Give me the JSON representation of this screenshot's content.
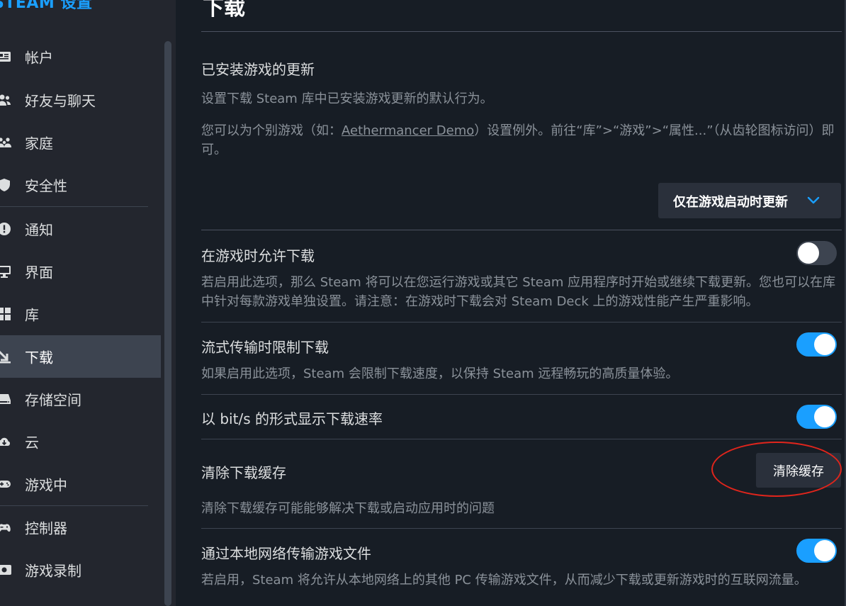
{
  "sidebar": {
    "title": "STEAM 设置",
    "items": [
      {
        "label": "帐户",
        "icon": "account-icon"
      },
      {
        "label": "好友与聊天",
        "icon": "friends-icon"
      },
      {
        "label": "家庭",
        "icon": "family-icon"
      },
      {
        "label": "安全性",
        "icon": "shield-icon"
      },
      {
        "label": "通知",
        "icon": "notification-icon"
      },
      {
        "label": "界面",
        "icon": "monitor-icon"
      },
      {
        "label": "库",
        "icon": "library-icon"
      },
      {
        "label": "下载",
        "icon": "download-icon",
        "active": true
      },
      {
        "label": "存储空间",
        "icon": "storage-icon"
      },
      {
        "label": "云",
        "icon": "cloud-icon"
      },
      {
        "label": "游戏中",
        "icon": "gamepad-icon"
      },
      {
        "label": "控制器",
        "icon": "controller-icon"
      },
      {
        "label": "游戏录制",
        "icon": "recording-icon"
      }
    ]
  },
  "main": {
    "title": "下载",
    "installed_updates": {
      "heading": "已安装游戏的更新",
      "desc1": "设置下载 Steam 库中已安装游戏更新的默认行为。",
      "desc2_before": "您可以为个别游戏（如：",
      "desc2_link": "Aethermancer Demo",
      "desc2_after": "）设置例外。前往“库”>“游戏”>“属性...”（从齿轮图标访问）即可。",
      "dropdown_value": "仅在游戏启动时更新"
    },
    "allow_during_gameplay": {
      "heading": "在游戏时允许下载",
      "desc": "若启用此选项，那么 Steam 将可以在您运行游戏或其它 Steam 应用程序时开始或继续下载更新。您也可以在库中针对每款游戏单独设置。请注意：在游戏时下载会对 Steam Deck 上的游戏性能产生严重影响。",
      "enabled": false
    },
    "throttle_streaming": {
      "heading": "流式传输时限制下载",
      "desc": "如果启用此选项，Steam 会限制下载速度，以保持 Steam 远程畅玩的高质量体验。",
      "enabled": true
    },
    "bits_per_second": {
      "heading": "以 bit/s 的形式显示下载速率",
      "enabled": true
    },
    "clear_cache": {
      "heading": "清除下载缓存",
      "button_label": "清除缓存",
      "desc": "清除下载缓存可能能够解决下载或启动应用时的问题"
    },
    "lan_transfer": {
      "heading": "通过本地网络传输游戏文件",
      "desc": "若启用，Steam 将允许从本地网络上的其他 PC 传输游戏文件，从而减少下载或更新游戏时的互联网流量。",
      "enabled": true
    }
  },
  "colors": {
    "accent": "#1a9fff",
    "annotation": "#e0251c",
    "background": "#171d25",
    "sidebar": "#23262e"
  }
}
